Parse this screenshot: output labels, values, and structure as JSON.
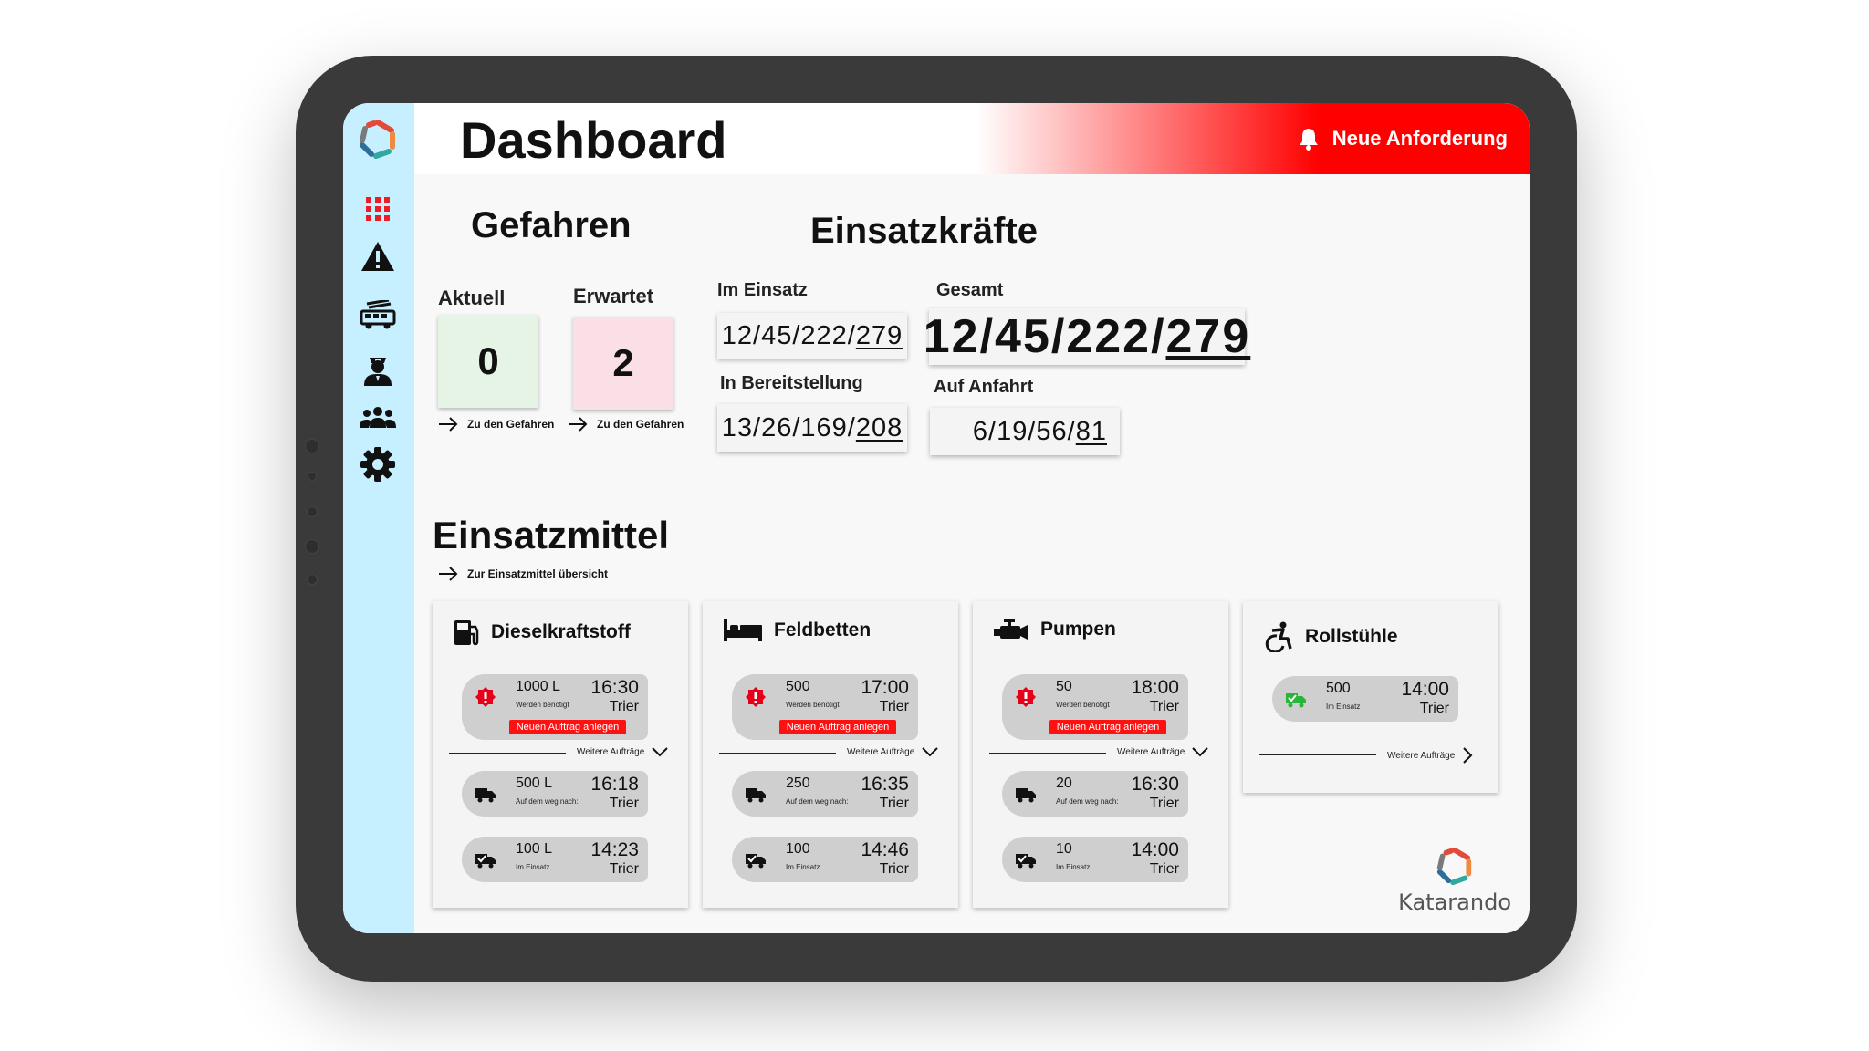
{
  "header": {
    "title": "Dashboard",
    "alert_label": "Neue Anforderung"
  },
  "sidebar": {
    "items": [
      {
        "icon": "grid-icon",
        "active": true
      },
      {
        "icon": "warning-icon"
      },
      {
        "icon": "fire-truck-icon"
      },
      {
        "icon": "officer-icon"
      },
      {
        "icon": "team-icon"
      },
      {
        "icon": "gear-icon"
      }
    ]
  },
  "gefahren": {
    "title": "Gefahren",
    "aktuell": {
      "label": "Aktuell",
      "value": "0",
      "link": "Zu den Gefahren",
      "color": "#e6f4e6"
    },
    "erwartet": {
      "label": "Erwartet",
      "value": "2",
      "link": "Zu den Gefahren",
      "color": "#fbdfe6"
    }
  },
  "einsatzkraefte": {
    "title": "Einsatzkräfte",
    "im_einsatz": {
      "label": "Im Einsatz",
      "value_main": "12/45/222/",
      "value_total": "279"
    },
    "gesamt": {
      "label": "Gesamt",
      "value_main": "12/45/222/",
      "value_total": "279"
    },
    "in_bereitstellung": {
      "label": "In Bereitstellung",
      "value_main": "13/26/169/",
      "value_total": "208"
    },
    "auf_anfahrt": {
      "label": "Auf Anfahrt",
      "value_main": "6/19/56/",
      "value_total": "81"
    }
  },
  "einsatzmittel": {
    "title": "Einsatzmittel",
    "link": "Zur Einsatzmittel übersicht",
    "more_label": "Weitere Aufträge",
    "new_order_label": "Neuen Auftrag anlegen",
    "cards": [
      {
        "name": "Dieselkraftstoff",
        "icon": "fuel-icon",
        "needed": {
          "qty": "1000 L",
          "sub": "Werden benötigt",
          "time": "16:30",
          "city": "Trier"
        },
        "transit": {
          "qty": "500 L",
          "sub": "Auf dem weg nach:",
          "time": "16:18",
          "city": "Trier"
        },
        "deployed": {
          "qty": "100 L",
          "sub": "Im Einsatz",
          "time": "14:23",
          "city": "Trier"
        }
      },
      {
        "name": "Feldbetten",
        "icon": "bed-icon",
        "needed": {
          "qty": "500",
          "sub": "Werden benötigt",
          "time": "17:00",
          "city": "Trier"
        },
        "transit": {
          "qty": "250",
          "sub": "Auf dem weg nach:",
          "time": "16:35",
          "city": "Trier"
        },
        "deployed": {
          "qty": "100",
          "sub": "Im Einsatz",
          "time": "14:46",
          "city": "Trier"
        }
      },
      {
        "name": "Pumpen",
        "icon": "pump-icon",
        "needed": {
          "qty": "50",
          "sub": "Werden benötigt",
          "time": "18:00",
          "city": "Trier"
        },
        "transit": {
          "qty": "20",
          "sub": "Auf dem weg nach:",
          "time": "16:30",
          "city": "Trier"
        },
        "deployed": {
          "qty": "10",
          "sub": "Im Einsatz",
          "time": "14:00",
          "city": "Trier"
        }
      },
      {
        "name": "Rollstühle",
        "icon": "wheelchair-icon",
        "deployed": {
          "qty": "500",
          "sub": "Im Einsatz",
          "time": "14:00",
          "city": "Trier"
        }
      }
    ]
  },
  "brand": {
    "name": "Katarando"
  },
  "colors": {
    "accent": "#ff0000",
    "sidebar": "#c6efff",
    "alert": "#e8001a",
    "ok": "#27b53a"
  }
}
